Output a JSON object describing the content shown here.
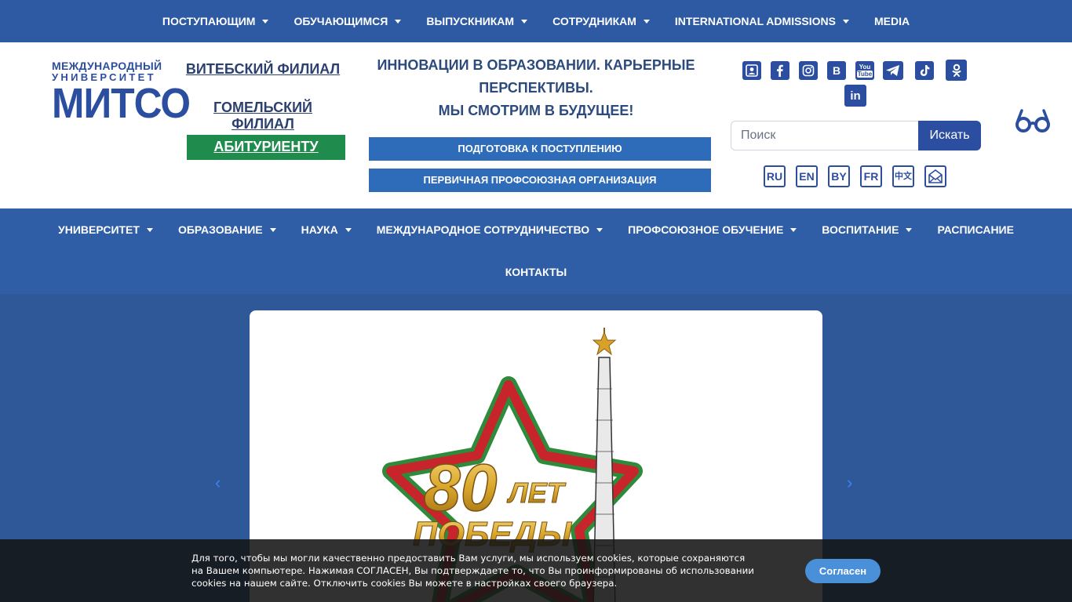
{
  "topbar": {
    "items": [
      {
        "label": "ПОСТУПАЮЩИМ",
        "has_dropdown": true
      },
      {
        "label": "ОБУЧАЮЩИМСЯ",
        "has_dropdown": true
      },
      {
        "label": "ВЫПУСКНИКАМ",
        "has_dropdown": true
      },
      {
        "label": "СОТРУДНИКАМ",
        "has_dropdown": true
      },
      {
        "label": "INTERNATIONAL ADMISSIONS",
        "has_dropdown": true
      },
      {
        "label": "MEDIA",
        "has_dropdown": false
      }
    ]
  },
  "logo": {
    "line1": "МЕЖДУНАРОДНЫЙ",
    "line2": "УНИВЕРСИТЕТ",
    "line3": "МИТСО"
  },
  "branches": {
    "vitebsk": "ВИТЕБСКИЙ ФИЛИАЛ",
    "gomel": "ГОМЕЛЬСКИЙ ФИЛИАЛ",
    "applicant": "АБИТУРИЕНТУ"
  },
  "slogan": {
    "line1": "ИННОВАЦИИ В ОБРАЗОВАНИИ. КАРЬЕРНЫЕ",
    "line2": "ПЕРСПЕКТИВЫ.",
    "line3": "МЫ СМОТРИМ В БУДУЩЕЕ!"
  },
  "buttons": {
    "prep": "ПОДГОТОВКА К ПОСТУПЛЕНИЮ",
    "union": "ПЕРВИЧНАЯ ПРОФСОЮЗНАЯ ОРГАНИЗАЦИЯ"
  },
  "social": {
    "icons": [
      "contact-card-icon",
      "facebook-icon",
      "instagram-icon",
      "vk-icon",
      "youtube-icon",
      "telegram-icon",
      "tiktok-icon",
      "odnoklassniki-icon",
      "linkedin-icon"
    ],
    "vk_glyph": "B",
    "youtube_line1": "You",
    "youtube_line2": "Tube",
    "linkedin_glyph": "in"
  },
  "search": {
    "placeholder": "Поиск",
    "button": "Искать"
  },
  "languages": [
    "RU",
    "EN",
    "BY",
    "FR",
    "中文"
  ],
  "mainnav": {
    "items": [
      {
        "label": "УНИВЕРСИТЕТ",
        "has_dropdown": true
      },
      {
        "label": "ОБРАЗОВАНИЕ",
        "has_dropdown": true
      },
      {
        "label": "НАУКА",
        "has_dropdown": true
      },
      {
        "label": "МЕЖДУНАРОДНОЕ СОТРУДНИЧЕСТВО",
        "has_dropdown": true
      },
      {
        "label": "ПРОФСОЮЗНОЕ ОБУЧЕНИЕ",
        "has_dropdown": true
      },
      {
        "label": "ВОСПИТАНИЕ",
        "has_dropdown": true
      },
      {
        "label": "РАСПИСАНИЕ",
        "has_dropdown": false
      }
    ],
    "contacts": "КОНТАКТЫ"
  },
  "slide": {
    "number": "80",
    "word1": "ЛЕТ",
    "word2": "ПОБЕДЫ"
  },
  "slider_arrows": {
    "prev": "‹",
    "next": "›"
  },
  "cookie": {
    "text": "Для того, чтобы мы могли качественно предоставить Вам услуги, мы используем cookies, которые сохраняются на Вашем компьютере. Нажимая СОГЛАСЕН, Вы подтверждаете то, что Вы проинформированы об использовании cookies на нашем сайте. Отключить cookies Вы можете в настройках своего браузера.",
    "button": "Согласен"
  },
  "colors": {
    "topbar": "#2d5aa3",
    "brand_blue": "#2c4ea0",
    "green": "#1f8c4d",
    "nav": "#2f5ea6",
    "slider_bg": "#2f5898",
    "cookie_btn": "#4a90d9"
  }
}
